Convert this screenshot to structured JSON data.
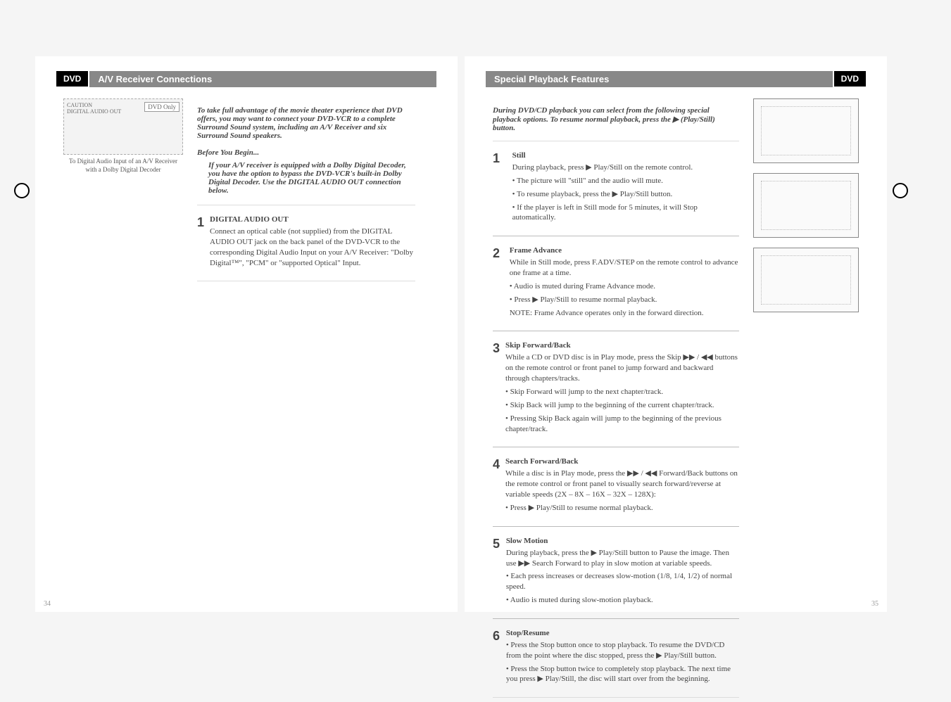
{
  "left": {
    "tag": "DVD",
    "title": "A/V Receiver Connections",
    "diagramCaption": "To Digital Audio Input of an A/V Receiver with a Dolby Digital Decoder",
    "intro": "To take full advantage of the movie theater experience that DVD offers, you may want to connect your DVD-VCR to a complete Surround Sound system, including an A/V Receiver and six Surround Sound speakers.",
    "before": "Before You Begin...",
    "beforeNote": "If your A/V receiver is equipped with a Dolby Digital Decoder, you have the option to bypass the DVD-VCR's built-in Dolby Digital Decoder. Use the DIGITAL AUDIO OUT connection below.",
    "step1Head": "DIGITAL AUDIO OUT",
    "step1Body": "Connect an optical cable (not supplied) from the DIGITAL AUDIO OUT jack on the back panel of the DVD-VCR to the corresponding Digital Audio Input on your A/V Receiver: \"Dolby Digital™\", \"PCM\" or \"supported Optical\" Input.",
    "pageNum": "34"
  },
  "right": {
    "tag": "DVD",
    "title": "Special Playback Features",
    "intro": "During DVD/CD playback you can select from the following special playback options. To resume normal playback, press the ▶ (Play/Still) button.",
    "s1h": "Still",
    "s1p": "During playback, press ▶ Play/Still on the remote control.",
    "s1a": "• The picture will \"still\" and the audio will mute.",
    "s1b": "• To resume playback, press the ▶ Play/Still button.",
    "s1c": "• If the player is left in Still mode for 5 minutes, it will Stop automatically.",
    "s2h": "Frame Advance",
    "s2p": "While in Still mode, press F.ADV/STEP on the remote control to advance one frame at a time.",
    "s2a": "• Audio is muted during Frame Advance mode.",
    "s2b": "• Press ▶ Play/Still to resume normal playback.",
    "s2c": "NOTE: Frame Advance operates only in the forward direction.",
    "s3h": "Skip Forward/Back",
    "s3p": "While a CD or DVD disc is in Play mode, press the Skip ▶▶ / ◀◀ buttons on the remote control or front panel to jump forward and backward through chapters/tracks.",
    "s3a": "• Skip Forward will jump to the next chapter/track.",
    "s3b": "• Skip Back will jump to the beginning of the current chapter/track.",
    "s3c": "• Pressing Skip Back again will jump to the beginning of the previous chapter/track.",
    "s4h": "Search Forward/Back",
    "s4p": "While a disc is in Play mode, press the ▶▶ / ◀◀ Forward/Back buttons on the remote control or front panel to visually search forward/reverse at variable speeds (2X – 8X – 16X – 32X – 128X):",
    "s4a": "• Press ▶ Play/Still to resume normal playback.",
    "s5h": "Slow Motion",
    "s5p": "During playback, press the ▶ Play/Still button to Pause the image. Then use ▶▶ Search Forward to play in slow motion at variable speeds.",
    "s5a": "• Each press increases or decreases slow-motion (1/8, 1/4, 1/2) of normal speed.",
    "s5b": "• Audio is muted during slow-motion playback.",
    "s6h": "Stop/Resume",
    "s6p": "• Press the Stop button once to stop playback. To resume the DVD/CD from the point where the disc stopped, press the ▶ Play/Still button.",
    "s6a": "• Press the Stop button twice to completely stop playback. The next time you press ▶ Play/Still, the disc will start over from the beginning.",
    "pageNum": "35"
  }
}
